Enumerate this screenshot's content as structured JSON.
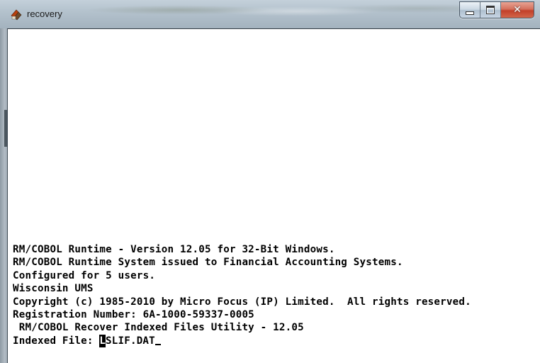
{
  "window": {
    "title": "recovery",
    "app_icon": "rm-cobol-app-icon",
    "caption_buttons": [
      "minimize-icon",
      "maximize-icon",
      "close-icon"
    ]
  },
  "console": {
    "lines": [
      "RM/COBOL Runtime - Version 12.05 for 32-Bit Windows.",
      "RM/COBOL Runtime System issued to Financial Accounting Systems.",
      "Configured for 5 users.",
      "Wisconsin UMS",
      "Copyright (c) 1985-2010 by Micro Focus (IP) Limited.  All rights reserved.",
      "Registration Number: 6A-1000-59337-0005",
      " RM/COBOL Recover Indexed Files Utility - 12.05"
    ],
    "prompt_label": "Indexed File: ",
    "input_first_char": "L",
    "input_rest": "SLIF.DAT"
  },
  "colors": {
    "background": "#ffffff",
    "text": "#000000",
    "close_button": "#c2402a"
  }
}
